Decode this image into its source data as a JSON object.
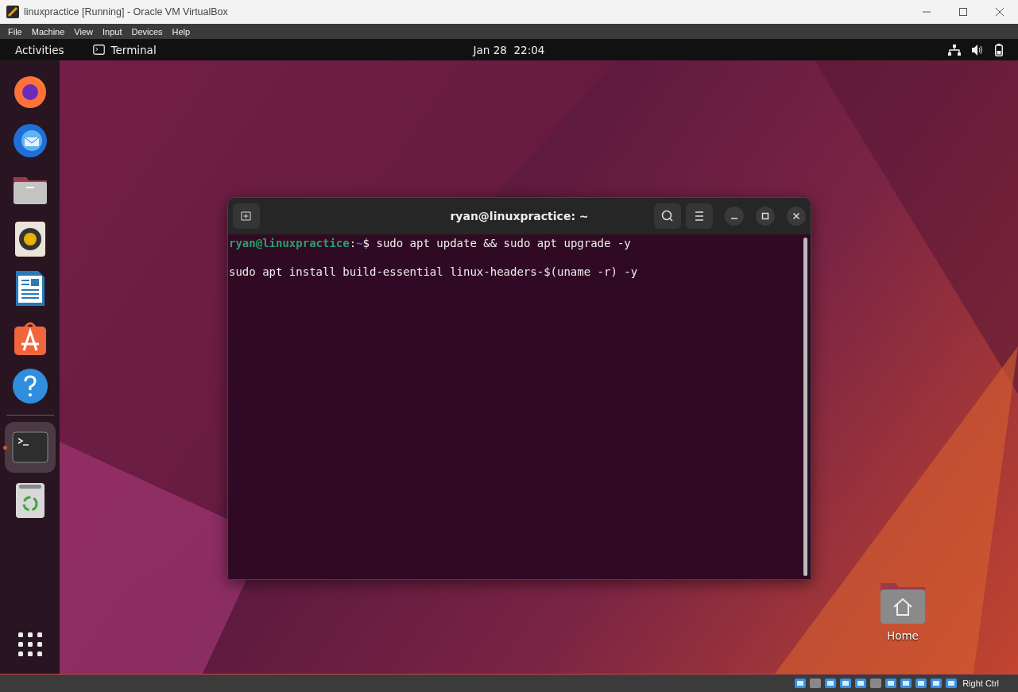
{
  "window": {
    "title": "linuxpractice [Running] - Oracle VM VirtualBox"
  },
  "menu": [
    "File",
    "Machine",
    "View",
    "Input",
    "Devices",
    "Help"
  ],
  "top_bar": {
    "activities": "Activities",
    "app": "Terminal",
    "clock": "Jan 28  22:04"
  },
  "dock": [
    {
      "kind": "firefox",
      "running": false
    },
    {
      "kind": "thunderbird",
      "running": false
    },
    {
      "kind": "files",
      "running": false
    },
    {
      "kind": "rhythmbox",
      "running": false
    },
    {
      "kind": "writer",
      "running": false
    },
    {
      "kind": "software",
      "running": false
    },
    {
      "kind": "help",
      "running": false
    },
    {
      "kind": "terminal",
      "running": true
    },
    {
      "kind": "trash",
      "running": false
    }
  ],
  "terminal": {
    "title": "ryan@linuxpractice: ~",
    "lines": [
      {
        "kind": "prompt",
        "user": "ryan@linuxpractice",
        "separator": ":",
        "path": "~",
        "command": "$ sudo apt update && sudo apt upgrade -y"
      },
      {
        "kind": "output",
        "text": "sudo apt install build-essential linux-headers-$(uname -r) -y"
      }
    ]
  },
  "desktop_icons": [
    {
      "label": "Home"
    }
  ],
  "status_bar": {
    "host_key": "Right Ctrl"
  }
}
